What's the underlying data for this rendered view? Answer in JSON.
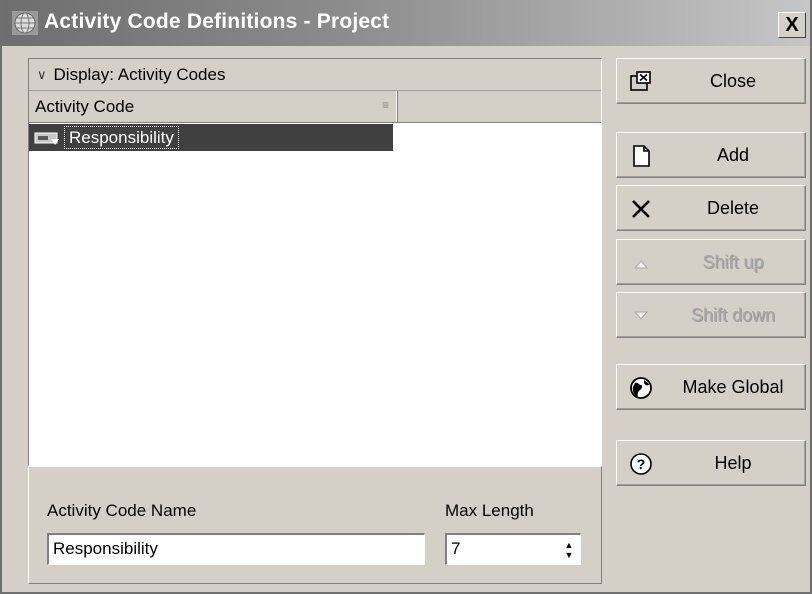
{
  "window": {
    "title": "Activity Code Definitions - Project",
    "close_glyph": "X"
  },
  "list": {
    "display_label": "Display: Activity Codes",
    "column_header": "Activity Code",
    "rows": [
      {
        "label": "Responsibility",
        "icon": "activity-code-icon",
        "selected": true
      }
    ]
  },
  "details": {
    "name_label": "Activity Code Name",
    "name_value": "Responsibility",
    "max_length_label": "Max Length",
    "max_length_value": "7"
  },
  "buttons": {
    "close": {
      "label": "Close",
      "icon": "close-window-icon"
    },
    "add": {
      "label": "Add",
      "icon": "new-document-icon"
    },
    "delete": {
      "label": "Delete",
      "icon": "x-delete-icon"
    },
    "shift_up": {
      "label": "Shift up",
      "icon": "up-triangle-icon",
      "enabled": false
    },
    "shift_down": {
      "label": "Shift down",
      "icon": "down-triangle-icon",
      "enabled": false
    },
    "make_global": {
      "label": "Make Global",
      "icon": "globe-icon"
    },
    "help": {
      "label": "Help",
      "icon": "help-icon"
    }
  },
  "colors": {
    "title_bar_start": "#6e6e6e",
    "dialog_bg": "#d4d0c8",
    "selection_bg": "#404040"
  }
}
